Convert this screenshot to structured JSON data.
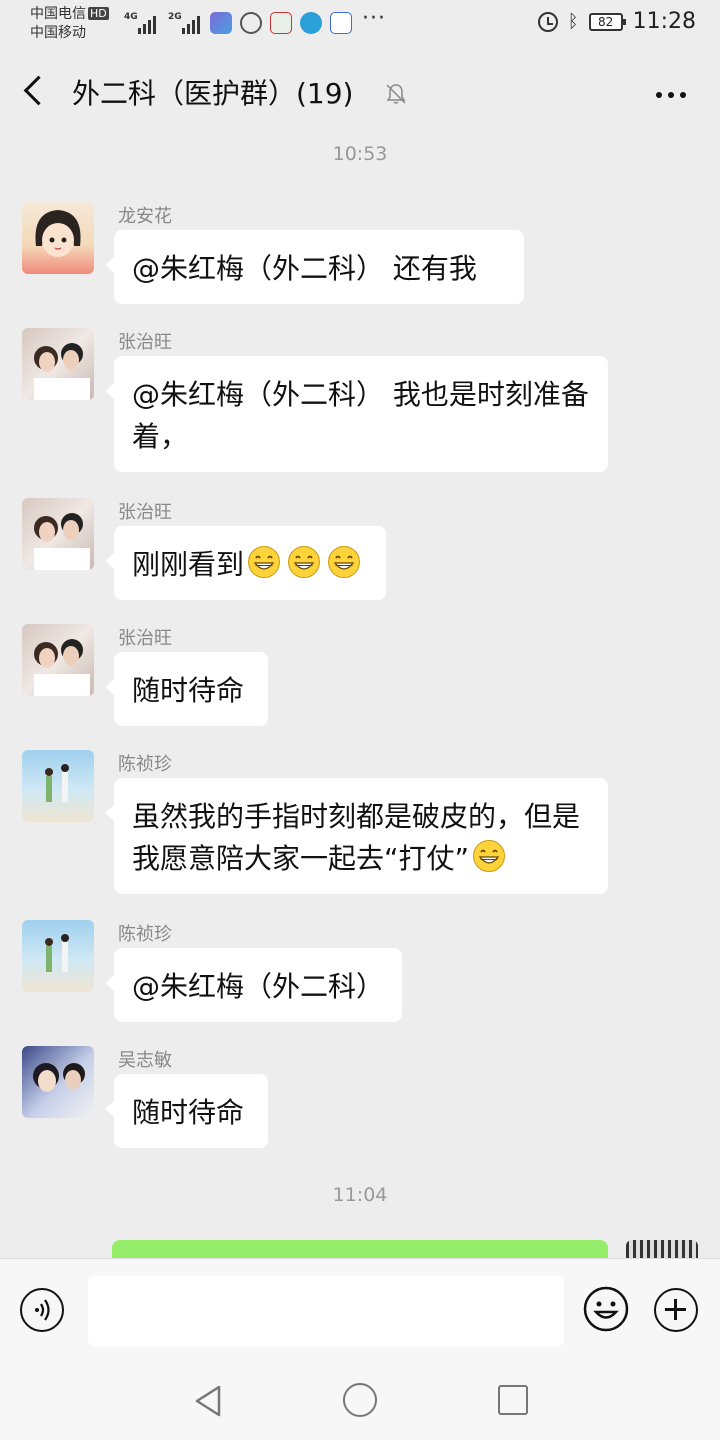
{
  "status": {
    "carrier1": "中国电信",
    "hd": "HD",
    "carrier2": "中国移动",
    "net1": "4G",
    "net2": "2G",
    "battery": "82",
    "time": "11:28"
  },
  "header": {
    "title": "外二科（医护群）(19)"
  },
  "timestamps": [
    "10:53",
    "11:04"
  ],
  "messages": [
    {
      "sender": "龙安花",
      "text": "@朱红梅（外二科） 还有我",
      "avatar_icon": "cartoon-girl-avatar"
    },
    {
      "sender": "张治旺",
      "text": "@朱红梅（外二科） 我也是时刻准备着，",
      "avatar_icon": "couple-photo-avatar"
    },
    {
      "sender": "张治旺",
      "text": "刚刚看到",
      "emoji": "grin-emoji",
      "emoji_count": 3,
      "avatar_icon": "couple-photo-avatar"
    },
    {
      "sender": "张治旺",
      "text": "随时待命",
      "avatar_icon": "couple-photo-avatar"
    },
    {
      "sender": "陈祯珍",
      "text": "虽然我的手指时刻都是破皮的，但是我愿意陪大家一起去“打仗”",
      "emoji": "grin-emoji",
      "avatar_icon": "beach-couple-avatar"
    },
    {
      "sender": "陈祯珍",
      "text": "@朱红梅（外二科）",
      "avatar_icon": "beach-couple-avatar"
    },
    {
      "sender": "吴志敏",
      "text": "随时待命",
      "avatar_icon": "selfie-avatar"
    }
  ],
  "colors": {
    "background": "#ededed",
    "self_bubble": "#95ec69",
    "bubble": "#ffffff"
  }
}
